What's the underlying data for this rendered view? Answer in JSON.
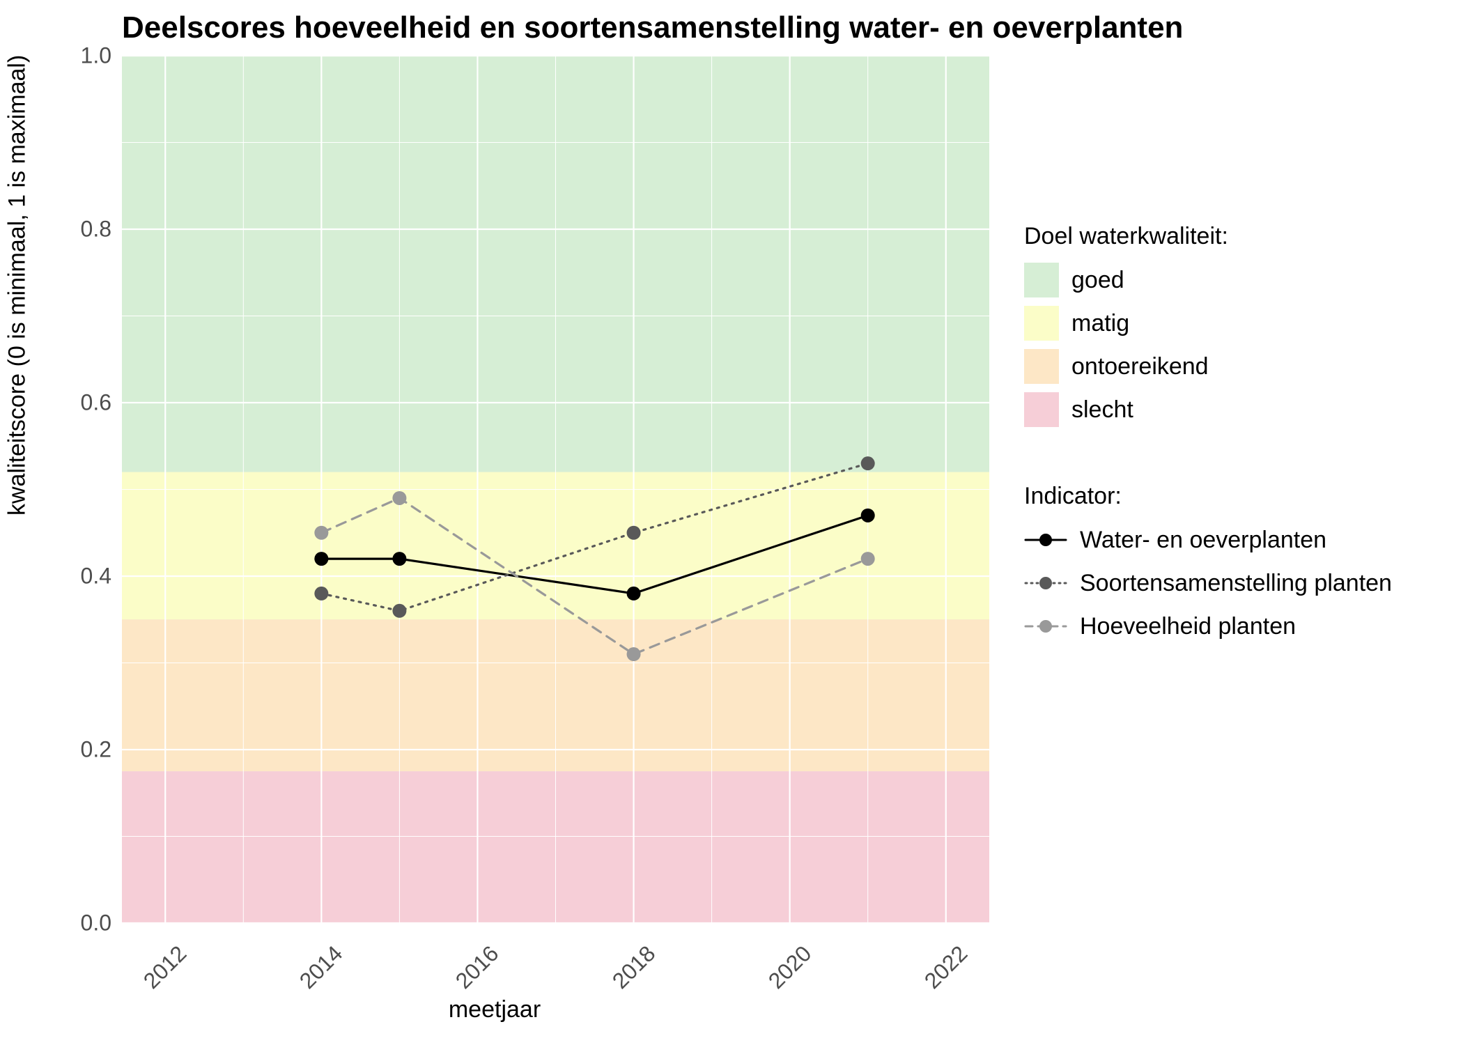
{
  "title": "Deelscores hoeveelheid en soortensamenstelling water- en oeverplanten",
  "xlabel": "meetjaar",
  "ylabel": "kwaliteitscore (0 is minimaal, 1 is maximaal)",
  "legend1": {
    "title": "Doel waterkwaliteit:",
    "items": [
      {
        "label": "goed",
        "color": "#d6eed5"
      },
      {
        "label": "matig",
        "color": "#fbfdc8"
      },
      {
        "label": "ontoereikend",
        "color": "#fde7c6"
      },
      {
        "label": "slecht",
        "color": "#f6ced7"
      }
    ]
  },
  "legend2": {
    "title": "Indicator:",
    "items": [
      {
        "label": "Water- en oeverplanten",
        "color": "#000000",
        "dot": "#000000",
        "dash": "solid"
      },
      {
        "label": "Soortensamenstelling planten",
        "color": "#595959",
        "dot": "#595959",
        "dash": "dotted"
      },
      {
        "label": "Hoeveelheid planten",
        "color": "#999999",
        "dot": "#999999",
        "dash": "dashed"
      }
    ]
  },
  "chart_data": {
    "type": "line",
    "title": "Deelscores hoeveelheid en soortensamenstelling water- en oeverplanten",
    "xlabel": "meetjaar",
    "ylabel": "kwaliteitscore (0 is minimaal, 1 is maximaal)",
    "xlim": [
      2012,
      2022
    ],
    "ylim": [
      0,
      1
    ],
    "x_ticks": [
      2012,
      2014,
      2016,
      2018,
      2020,
      2022
    ],
    "y_ticks": [
      0.0,
      0.2,
      0.4,
      0.6,
      0.8,
      1.0
    ],
    "bands": [
      {
        "name": "goed",
        "ymin": 0.52,
        "ymax": 1.0,
        "color": "#d6eed5"
      },
      {
        "name": "matig",
        "ymin": 0.35,
        "ymax": 0.52,
        "color": "#fbfdc8"
      },
      {
        "name": "ontoereikend",
        "ymin": 0.175,
        "ymax": 0.35,
        "color": "#fde7c6"
      },
      {
        "name": "slecht",
        "ymin": 0.0,
        "ymax": 0.175,
        "color": "#f6ced7"
      }
    ],
    "series": [
      {
        "name": "Water- en oeverplanten",
        "color": "#000000",
        "dot_color": "#000000",
        "dash": "solid",
        "x": [
          2014,
          2015,
          2018,
          2021
        ],
        "y": [
          0.42,
          0.42,
          0.38,
          0.47
        ]
      },
      {
        "name": "Soortensamenstelling planten",
        "color": "#595959",
        "dot_color": "#595959",
        "dash": "dotted",
        "x": [
          2014,
          2015,
          2018,
          2021
        ],
        "y": [
          0.38,
          0.36,
          0.45,
          0.53
        ]
      },
      {
        "name": "Hoeveelheid planten",
        "color": "#999999",
        "dot_color": "#999999",
        "dash": "dashed",
        "x": [
          2014,
          2015,
          2018,
          2021
        ],
        "y": [
          0.45,
          0.49,
          0.31,
          0.42
        ]
      }
    ]
  }
}
